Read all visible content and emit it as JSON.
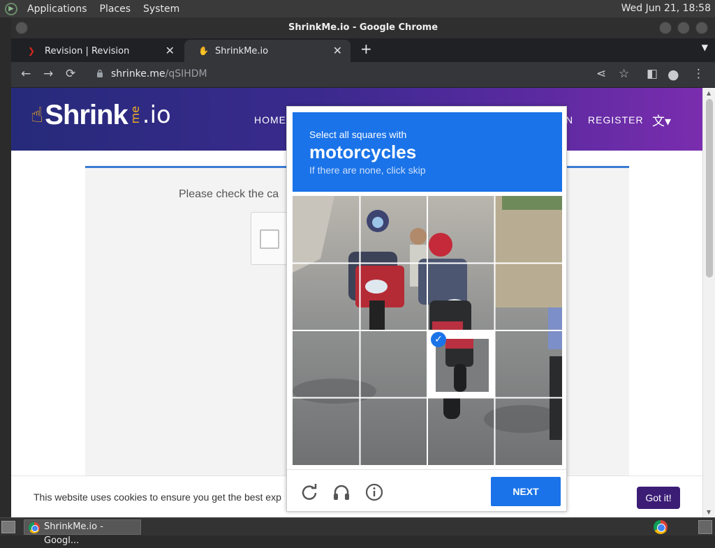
{
  "panel": {
    "menus": [
      "Applications",
      "Places",
      "System"
    ],
    "clock": "Wed Jun 21, 18:58"
  },
  "window": {
    "title": "ShrinkMe.io - Google Chrome"
  },
  "tabs": [
    {
      "label": "Revision | Revision",
      "favicon": "revision-favicon",
      "active": false
    },
    {
      "label": "ShrinkMe.io",
      "favicon": "shrinkme-hand-favicon",
      "active": true
    }
  ],
  "toolbar": {
    "url_domain": "shrinke.me",
    "url_path": "/qSIHDM"
  },
  "site": {
    "logo_main": "Shrink",
    "logo_me": "me",
    "logo_tld": ".io",
    "nav": {
      "home": "HOME",
      "login_partial": "N",
      "register": "REGISTER"
    }
  },
  "page": {
    "check_text": "Please check the ca"
  },
  "cookie": {
    "text": "This website uses cookies to ensure you get the best exp",
    "button": "Got it!"
  },
  "challenge": {
    "line1": "Select all squares with",
    "target": "motorcycles",
    "subtitle": "If there are none, click skip",
    "next_label": "NEXT",
    "grid_rows": 4,
    "grid_cols": 4,
    "selected_tiles": [
      {
        "row": 2,
        "col": 2
      }
    ]
  },
  "taskbar": {
    "task_label": "ShrinkMe.io - Googl..."
  },
  "colors": {
    "accent": "#1a73e8",
    "header_gradient_start": "#262a7a",
    "header_gradient_end": "#7a2dae",
    "cookie_button": "#3b1d75",
    "logo_yellow": "#f4b21f"
  }
}
